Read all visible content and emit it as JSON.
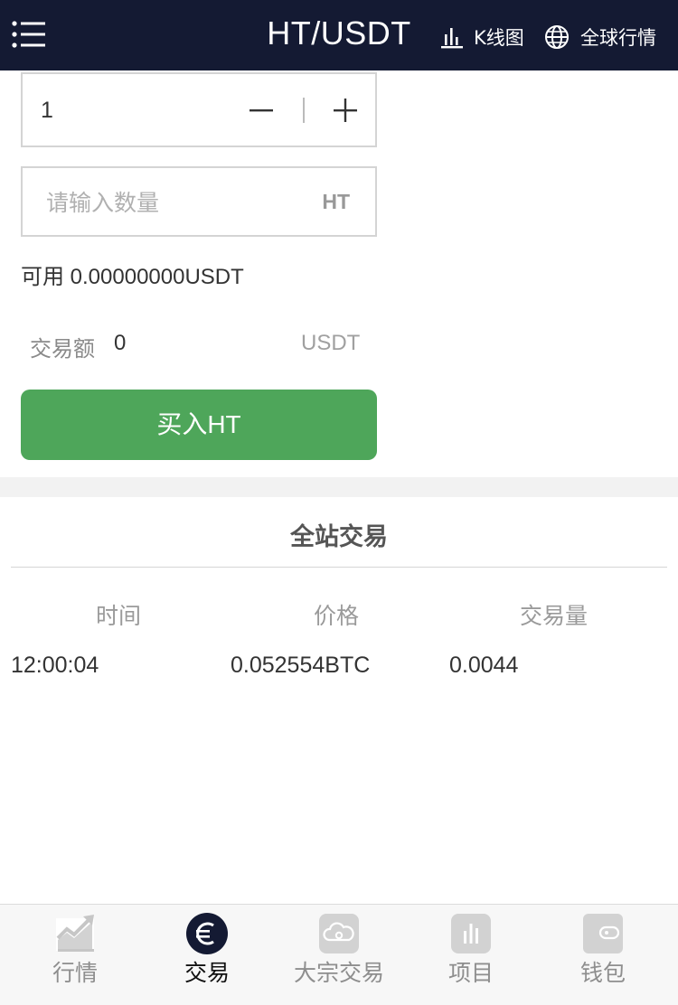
{
  "header": {
    "title": "HT/USDT",
    "kline_label": "K线图",
    "market_label": "全球行情",
    "bg_color": "#141a33"
  },
  "form": {
    "price_value": "1",
    "amount_placeholder": "请输入数量",
    "amount_unit": "HT",
    "available_text": "可用 0.00000000USDT",
    "trade_total_label": "交易额",
    "trade_total_value": "0",
    "trade_total_unit": "USDT",
    "buy_button_label": "买入HT",
    "buy_button_color": "#4ea65a"
  },
  "trades": {
    "title": "全站交易",
    "columns": [
      "时间",
      "价格",
      "交易量"
    ],
    "rows": [
      {
        "time": "12:00:04",
        "price": "0.052554BTC",
        "volume": "0.0044"
      }
    ]
  },
  "tabbar": {
    "items": [
      {
        "label": "行情",
        "icon": "chart-trend-icon",
        "active": false
      },
      {
        "label": "交易",
        "icon": "euro-icon",
        "active": true
      },
      {
        "label": "大宗交易",
        "icon": "cloud-coin-icon",
        "active": false
      },
      {
        "label": "项目",
        "icon": "bar-chart-icon",
        "active": false
      },
      {
        "label": "钱包",
        "icon": "wallet-icon",
        "active": false
      }
    ]
  }
}
